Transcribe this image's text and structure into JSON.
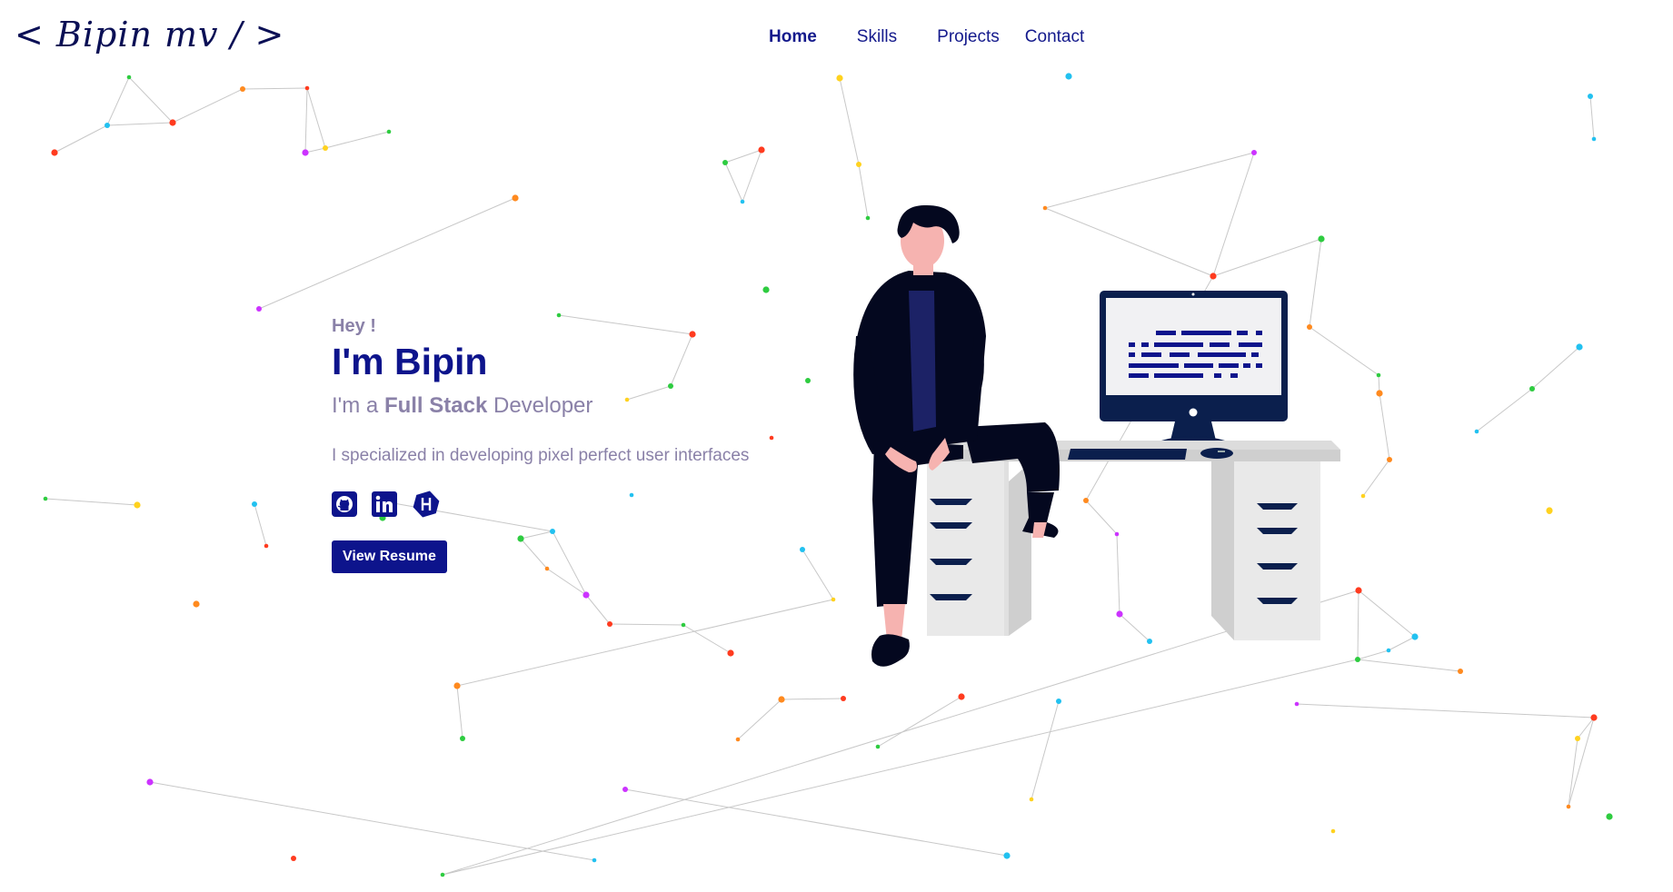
{
  "header": {
    "logo": "< Bipin mv / >",
    "nav": [
      {
        "label": "Home",
        "active": true
      },
      {
        "label": "Skills",
        "active": false
      },
      {
        "label": "Projects",
        "active": false
      },
      {
        "label": "Contact",
        "active": false
      }
    ]
  },
  "hero": {
    "greeting": "Hey !",
    "name": "I'm Bipin",
    "role_prefix": "I'm a",
    "role_highlight": "Full Stack",
    "role_suffix": "Developer",
    "description": "I specialized in developing pixel perfect user interfaces",
    "socials": [
      {
        "icon": "github-icon"
      },
      {
        "icon": "linkedin-icon"
      },
      {
        "icon": "hashnode-icon"
      }
    ],
    "resume_button": "View Resume"
  },
  "colors": {
    "primary": "#0d148c",
    "muted_text": "#8a81a8",
    "illustration_dark": "#04081f",
    "particles": [
      "#ff3b1f",
      "#ff8a1f",
      "#ffd21f",
      "#2ecc40",
      "#22c1f0",
      "#cc33ff"
    ]
  }
}
